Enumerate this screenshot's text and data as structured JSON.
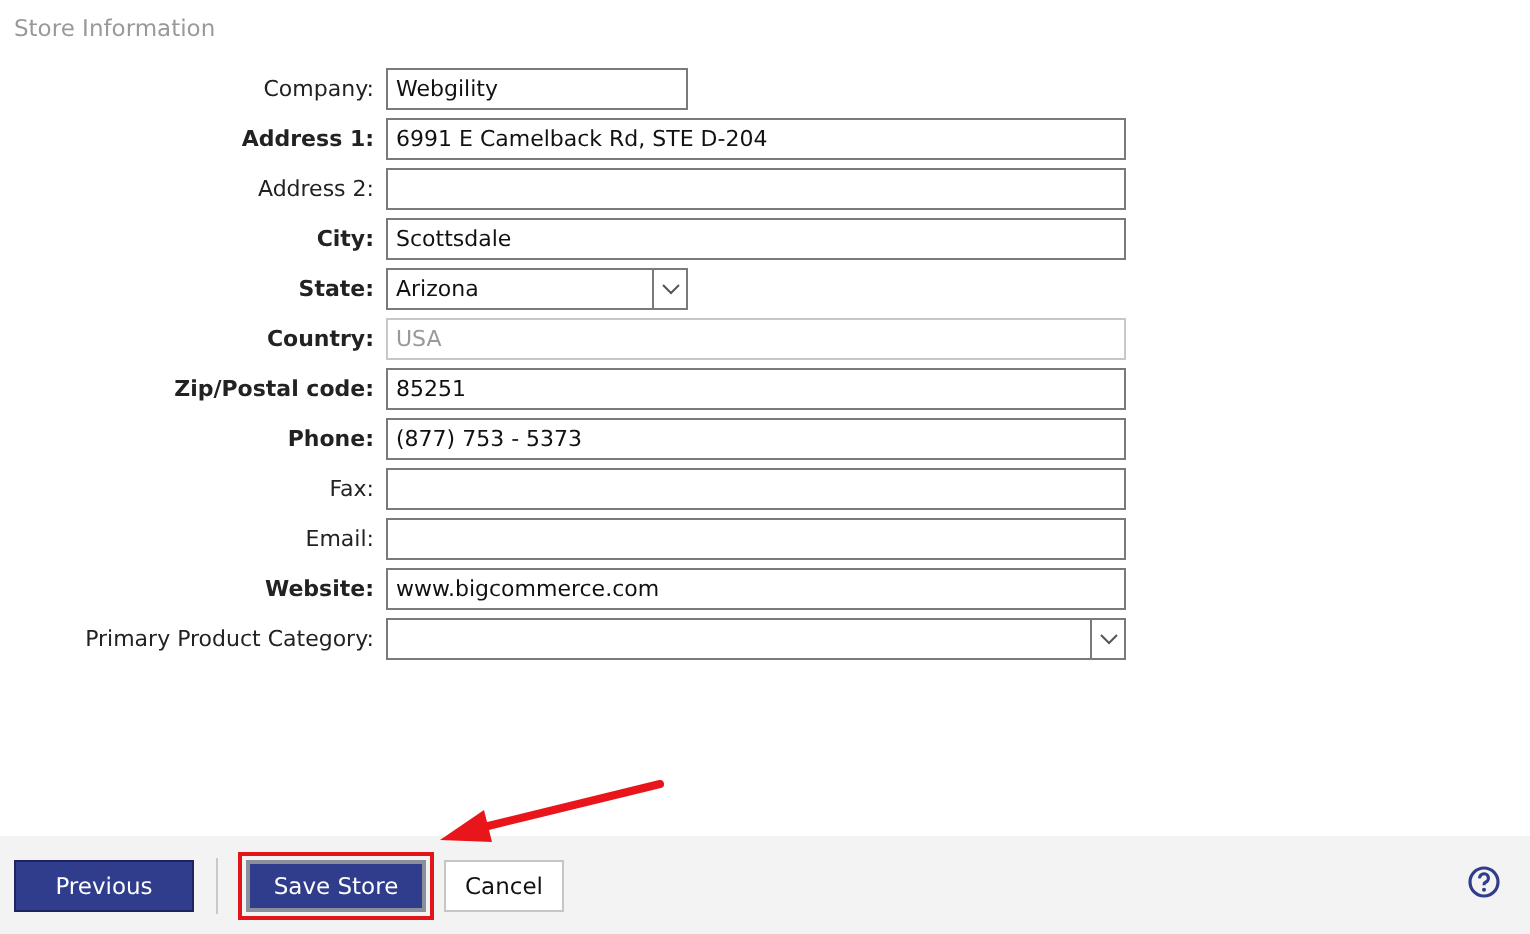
{
  "section_title": "Store Information",
  "fields": [
    {
      "label": "Company:",
      "kind": "short_text",
      "value": "Webgility",
      "required": false,
      "disabled": false
    },
    {
      "label": "Address 1:",
      "kind": "text",
      "value": "6991 E Camelback Rd, STE D-204",
      "required": true,
      "disabled": false
    },
    {
      "label": "Address 2:",
      "kind": "text",
      "required": false,
      "disabled": false
    },
    {
      "label": "City:",
      "kind": "text",
      "value": "Scottsdale",
      "required": true,
      "disabled": false
    },
    {
      "label": "State:",
      "kind": "short_select",
      "value": "Arizona",
      "required": true,
      "disabled": false
    },
    {
      "label": "Country:",
      "kind": "text",
      "value": "USA",
      "required": true,
      "disabled": true
    },
    {
      "label": "Zip/Postal code:",
      "kind": "text",
      "value": "85251",
      "required": true,
      "disabled": false
    },
    {
      "label": "Phone:",
      "kind": "text",
      "value": "(877) 753 - 5373",
      "required": true,
      "disabled": false
    },
    {
      "label": "Fax:",
      "kind": "text",
      "required": false,
      "disabled": false
    },
    {
      "label": "Email:",
      "kind": "text",
      "required": false,
      "disabled": false
    },
    {
      "label": "Website:",
      "kind": "text",
      "value": "www.bigcommerce.com",
      "required": true,
      "disabled": false
    },
    {
      "label": "Primary Product Category:",
      "kind": "select",
      "required": false,
      "disabled": false
    }
  ],
  "footer": {
    "buttons": [
      {
        "label": "Previous",
        "kind": "primary",
        "highlighted": false
      },
      {
        "label": "Save Store",
        "kind": "primary",
        "highlighted": true
      },
      {
        "label": "Cancel",
        "kind": "secondary",
        "highlighted": false
      }
    ]
  }
}
